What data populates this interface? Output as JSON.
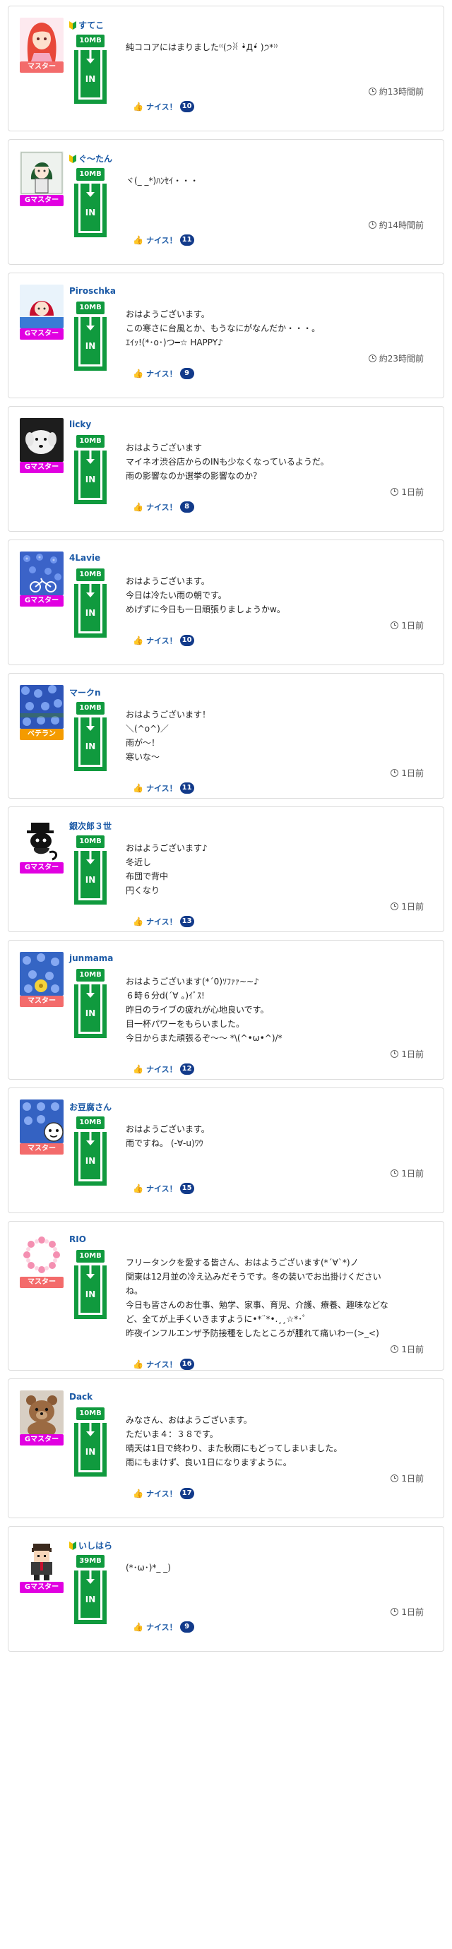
{
  "common": {
    "in_label": "IN",
    "nice_label": "ナイス！"
  },
  "colors": {
    "master": "#f36b6b",
    "gmaster": "#e100e1",
    "veteran": "#f49b00",
    "size_badge": "#109a3e",
    "link": "#1c5aa6"
  },
  "posts": [
    {
      "user": "すてこ",
      "beginner": true,
      "rank": "マスター",
      "rank_type": "master",
      "size": "10MB",
      "avatar": "anime-girl-red-hair",
      "message": "純ココアにはまりました⁽⁽(੭ꐦ •̀Д•́ )੭*⁾⁾",
      "time": "約13時間前",
      "nice": "10"
    },
    {
      "user": "ぐ〜たん",
      "beginner": true,
      "rank": "Gマスター",
      "rank_type": "gmaster",
      "size": "10MB",
      "avatar": "anime-girl-green-hair",
      "message": "ヾ(_ _*)ﾊﾝｾｲ・・・",
      "time": "約14時間前",
      "nice": "11"
    },
    {
      "user": "Piroschka",
      "beginner": false,
      "rank": "Gマスター",
      "rank_type": "gmaster",
      "size": "10MB",
      "avatar": "red-riding-hood",
      "message": "おはようございます。\nこの寒さに台風とか、もうなにがなんだか・・・。\nｴｲｯ!(*･o･)つ━☆ HAPPY♪",
      "time": "約23時間前",
      "nice": "9"
    },
    {
      "user": "licky",
      "beginner": false,
      "rank": "Gマスター",
      "rank_type": "gmaster",
      "size": "10MB",
      "avatar": "white-dog",
      "message": "おはようございます\nマイネオ渋谷店からのINも少なくなっているようだ。\n雨の影響なのか選挙の影響なのか？",
      "time": "1日前",
      "nice": "8"
    },
    {
      "user": "4Lavie",
      "beginner": false,
      "rank": "Gマスター",
      "rank_type": "gmaster",
      "size": "10MB",
      "avatar": "blue-flowers-bike",
      "message": "おはようございます。\n今日は冷たい雨の朝です。\nめげずに今日も一日頑張りましょうかw。",
      "time": "1日前",
      "nice": "10"
    },
    {
      "user": "マークn",
      "beginner": false,
      "rank": "ベテラン",
      "rank_type": "veteran",
      "size": "10MB",
      "avatar": "blue-flowers",
      "message": "おはようございます！\n＼(^o^)／\n雨が〜！\n寒いな〜",
      "time": "1日前",
      "nice": "11"
    },
    {
      "user": "銀次郎３世",
      "beginner": false,
      "rank": "Gマスター",
      "rank_type": "gmaster",
      "size": "10MB",
      "avatar": "black-cat-hat",
      "message": "おはようございます♪\n冬近し\n布団で背中\n円くなり",
      "time": "1日前",
      "nice": "13"
    },
    {
      "user": "junmama",
      "beginner": false,
      "rank": "マスター",
      "rank_type": "master",
      "size": "10MB",
      "avatar": "blue-flowers-yellow",
      "message": "おはようございます(*´0)ｿﾌｧｧ~~♪\n６時６分d(´∀ ｡)ｲﾞｽ!\n昨日のライブの疲れが心地良いです。\n目一杯パワーをもらいました。\n今日からまた頑張るぞ〜〜 *\\(^•ω•^)/*",
      "time": "1日前",
      "nice": "12"
    },
    {
      "user": "お豆腐さん",
      "beginner": false,
      "rank": "マスター",
      "rank_type": "master",
      "size": "10MB",
      "avatar": "blue-flowers-mascot",
      "message": "おはようございます。\n雨ですね。 (-∀-u)ﾜｳ",
      "time": "1日前",
      "nice": "15"
    },
    {
      "user": "RIO",
      "beginner": false,
      "rank": "マスター",
      "rank_type": "master",
      "size": "10MB",
      "avatar": "pink-flower-ring",
      "message": "フリータンクを愛する皆さん、おはようございます(*´∀`*)ノ\n関東は12月並の冷え込みだそうです。冬の装いでお出掛けください\nね。\n今日も皆さんのお仕事、勉学、家事、育児、介護、療養、趣味などな\nど、全てが上手くいきますように•*¨*•.¸¸☆*･ﾟ\n昨夜インフルエンザ予防接種をしたところが腫れて痛いわー(>_<)",
      "time": "1日前",
      "nice": "16"
    },
    {
      "user": "Dack",
      "beginner": false,
      "rank": "Gマスター",
      "rank_type": "gmaster",
      "size": "10MB",
      "avatar": "teddy-bear",
      "message": "みなさん、おはようございます。\nただいま４：３８です。\n晴天は1日で終わり、また秋雨にもどってしまいました。\n雨にもまけず、良い1日になりますように。",
      "time": "1日前",
      "nice": "17"
    },
    {
      "user": "いしはら",
      "beginner": true,
      "rank": "Gマスター",
      "rank_type": "gmaster",
      "size": "39MB",
      "avatar": "pixel-boy",
      "message": "(*･ω･)*_ _)",
      "time": "1日前",
      "nice": "9"
    }
  ]
}
